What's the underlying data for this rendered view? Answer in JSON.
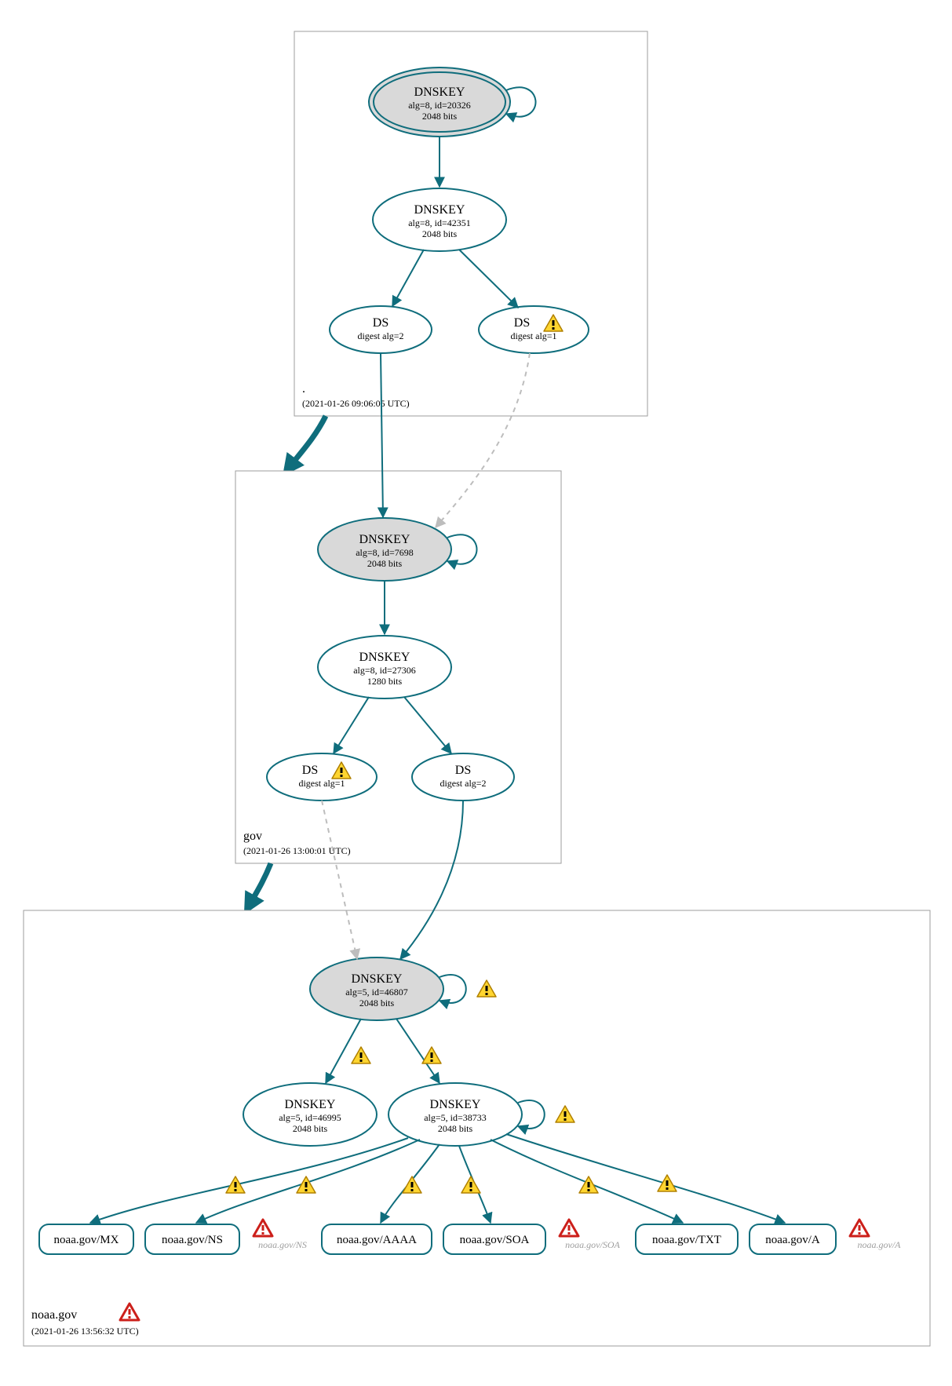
{
  "chart_data": {
    "type": "diagram",
    "description": "DNSSEC authentication chain / DNSViz-style diagram for noaa.gov",
    "zones": [
      {
        "name": ".",
        "timestamp": "(2021-01-26 09:06:05 UTC)",
        "nodes": [
          {
            "id": "root-ksk",
            "type": "DNSKEY",
            "alg": "alg=8, id=20326",
            "bits": "2048 bits",
            "trust_anchor": true,
            "self_loop": true
          },
          {
            "id": "root-zsk",
            "type": "DNSKEY",
            "alg": "alg=8, id=42351",
            "bits": "2048 bits"
          },
          {
            "id": "root-ds2",
            "type": "DS",
            "sub": "digest alg=2"
          },
          {
            "id": "root-ds1",
            "type": "DS",
            "sub": "digest alg=1",
            "warn": true
          }
        ]
      },
      {
        "name": "gov",
        "timestamp": "(2021-01-26 13:00:01 UTC)",
        "nodes": [
          {
            "id": "gov-ksk",
            "type": "DNSKEY",
            "alg": "alg=8, id=7698",
            "bits": "2048 bits",
            "shaded": true,
            "self_loop": true
          },
          {
            "id": "gov-zsk",
            "type": "DNSKEY",
            "alg": "alg=8, id=27306",
            "bits": "1280 bits"
          },
          {
            "id": "gov-ds1",
            "type": "DS",
            "sub": "digest alg=1",
            "warn": true
          },
          {
            "id": "gov-ds2",
            "type": "DS",
            "sub": "digest alg=2"
          }
        ]
      },
      {
        "name": "noaa.gov",
        "timestamp": "(2021-01-26 13:56:32 UTC)",
        "zone_warn": "error",
        "nodes": [
          {
            "id": "noaa-ksk",
            "type": "DNSKEY",
            "alg": "alg=5, id=46807",
            "bits": "2048 bits",
            "shaded": true,
            "self_loop": true,
            "loop_warn": true
          },
          {
            "id": "noaa-zsk1",
            "type": "DNSKEY",
            "alg": "alg=5, id=46995",
            "bits": "2048 bits"
          },
          {
            "id": "noaa-zsk2",
            "type": "DNSKEY",
            "alg": "alg=5, id=38733",
            "bits": "2048 bits",
            "self_loop": true,
            "loop_warn": true
          }
        ],
        "leaves": [
          {
            "id": "leaf-mx",
            "label": "noaa.gov/MX"
          },
          {
            "id": "leaf-ns",
            "label": "noaa.gov/NS"
          },
          {
            "id": "ghost-ns",
            "label": "noaa.gov/NS",
            "ghost": true,
            "error": true
          },
          {
            "id": "leaf-aaaa",
            "label": "noaa.gov/AAAA"
          },
          {
            "id": "leaf-soa",
            "label": "noaa.gov/SOA"
          },
          {
            "id": "ghost-soa",
            "label": "noaa.gov/SOA",
            "ghost": true,
            "error": true
          },
          {
            "id": "leaf-txt",
            "label": "noaa.gov/TXT"
          },
          {
            "id": "leaf-a",
            "label": "noaa.gov/A"
          },
          {
            "id": "ghost-a",
            "label": "noaa.gov/A",
            "ghost": true,
            "error": true
          }
        ]
      }
    ],
    "edges": [
      {
        "from": "root-ksk",
        "to": "root-zsk",
        "style": "solid"
      },
      {
        "from": "root-zsk",
        "to": "root-ds2",
        "style": "solid"
      },
      {
        "from": "root-zsk",
        "to": "root-ds1",
        "style": "solid"
      },
      {
        "from": "root-zone",
        "to": "gov-zone",
        "style": "thick"
      },
      {
        "from": "root-ds2",
        "to": "gov-ksk",
        "style": "solid"
      },
      {
        "from": "root-ds1",
        "to": "gov-ksk",
        "style": "dashed"
      },
      {
        "from": "gov-ksk",
        "to": "gov-zsk",
        "style": "solid"
      },
      {
        "from": "gov-zsk",
        "to": "gov-ds1",
        "style": "solid"
      },
      {
        "from": "gov-zsk",
        "to": "gov-ds2",
        "style": "solid"
      },
      {
        "from": "gov-zone",
        "to": "noaa-zone",
        "style": "thick"
      },
      {
        "from": "gov-ds1",
        "to": "noaa-ksk",
        "style": "dashed"
      },
      {
        "from": "gov-ds2",
        "to": "noaa-ksk",
        "style": "solid"
      },
      {
        "from": "noaa-ksk",
        "to": "noaa-zsk1",
        "style": "solid",
        "warn": true
      },
      {
        "from": "noaa-ksk",
        "to": "noaa-zsk2",
        "style": "solid",
        "warn": true
      },
      {
        "from": "noaa-zsk2",
        "to": "leaf-mx",
        "style": "solid",
        "warn": true
      },
      {
        "from": "noaa-zsk2",
        "to": "leaf-ns",
        "style": "solid",
        "warn": true
      },
      {
        "from": "noaa-zsk2",
        "to": "leaf-aaaa",
        "style": "solid",
        "warn": true
      },
      {
        "from": "noaa-zsk2",
        "to": "leaf-soa",
        "style": "solid",
        "warn": true
      },
      {
        "from": "noaa-zsk2",
        "to": "leaf-txt",
        "style": "solid",
        "warn": true
      },
      {
        "from": "noaa-zsk2",
        "to": "leaf-a",
        "style": "solid",
        "warn": true
      }
    ]
  }
}
